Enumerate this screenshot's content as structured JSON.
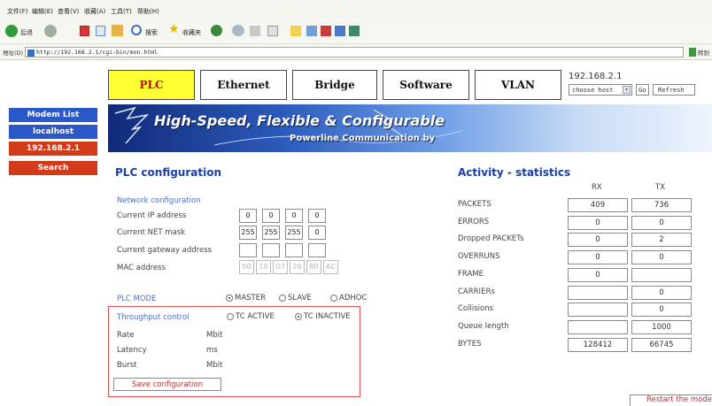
{
  "browser": {
    "menu": [
      "文件(F)",
      "编辑(E)",
      "查看(V)",
      "收藏(A)",
      "工具(T)",
      "帮助(H)"
    ],
    "back_label": "后退",
    "search_label": "搜索",
    "favorites_label": "收藏夹",
    "address_label": "地址(D)",
    "url": "http://192.168.2.1/cgi-bin/mon.html",
    "go_label": "转到"
  },
  "nav": {
    "tabs": [
      "PLC",
      "Ethernet",
      "Bridge",
      "Software",
      "VLAN"
    ],
    "active_tab": "PLC",
    "host_ip": "192.168.2.1",
    "host_select": "choose host",
    "go_button": "Go",
    "refresh_button": "Refresh"
  },
  "sidebar": {
    "items": [
      "Modem List",
      "localhost",
      "192.168.2.1",
      "Search"
    ]
  },
  "banner": {
    "headline": "High-Speed, Flexible & Configurable",
    "subline": "Powerline Communication by"
  },
  "plc": {
    "title": "PLC configuration",
    "network_heading": "Network configuration",
    "ip_label": "Current IP address",
    "ip": [
      "0",
      "0",
      "0",
      "0"
    ],
    "mask_label": "Current NET mask",
    "mask": [
      "255",
      "255",
      "255",
      "0"
    ],
    "gateway_label": "Current gateway address",
    "gateway": [
      "",
      "",
      "",
      ""
    ],
    "mac_label": "MAC address",
    "mac": [
      "00",
      "10",
      "D7",
      "20",
      "80",
      "AC"
    ],
    "mode_label": "PLC MODE",
    "modes": [
      "MASTER",
      "SLAVE",
      "ADHOC"
    ],
    "mode_selected": "MASTER",
    "throughput_label": "Throughput control",
    "tc_options": [
      "TC ACTIVE",
      "TC INACTIVE"
    ],
    "tc_selected": "TC INACTIVE",
    "rate_label": "Rate",
    "rate_unit": "Mbit",
    "latency_label": "Latency",
    "latency_unit": "ms",
    "burst_label": "Burst",
    "burst_unit": "Mbit",
    "save_button": "Save configuration"
  },
  "stats": {
    "title": "Activity - statistics",
    "rx_header": "RX",
    "tx_header": "TX",
    "rows": [
      {
        "label": "PACKETS",
        "rx": "409",
        "tx": "736"
      },
      {
        "label": "ERRORS",
        "rx": "0",
        "tx": "0"
      },
      {
        "label": "Dropped PACKETs",
        "rx": "0",
        "tx": "2"
      },
      {
        "label": "OVERRUNS",
        "rx": "0",
        "tx": "0"
      },
      {
        "label": "FRAME",
        "rx": "0",
        "tx": null
      },
      {
        "label": "CARRIERs",
        "rx": "",
        "tx": "0"
      },
      {
        "label": "Collisions",
        "rx": "",
        "tx": "0"
      },
      {
        "label": "Queue length",
        "rx": "",
        "tx": "1000"
      },
      {
        "label": "BYTES",
        "rx": "128412",
        "tx": "66745"
      }
    ]
  },
  "restart_button": "Restart the mode",
  "colors": {
    "tab_active_bg": "#ffff33",
    "tab_active_text": "#cc0000",
    "sidebar_blue": "#2a58c8",
    "sidebar_red": "#d23a1a",
    "heading_blue": "#1a3ea8",
    "box_red": "#e05050"
  }
}
